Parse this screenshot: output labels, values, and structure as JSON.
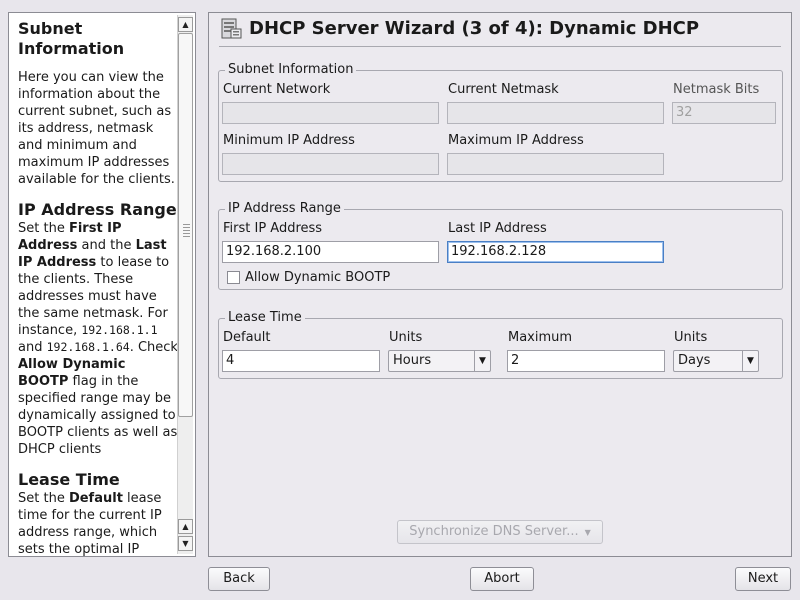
{
  "help": {
    "title": "Subnet Information",
    "intro": "Here you can view the information about the current subnet, such as its address, netmask and minimum and maximum IP addresses available for the clients.",
    "range_heading": "IP Address Range",
    "range_p1": "Set the ",
    "range_b1": "First IP Address",
    "range_p2": " and the ",
    "range_b2": "Last IP Address",
    "range_p3": " to lease to the clients. These addresses must have the same netmask. For instance, ",
    "range_code1": "192.168.1.1",
    "range_p4": " and ",
    "range_code2": "192.168.1.64",
    "range_p5": ". Check ",
    "range_b3": "Allow Dynamic BOOTP",
    "range_p6": " flag in the specified range may be dynamically assigned to BOOTP clients as well as DHCP clients",
    "lease_heading": "Lease Time",
    "lease_p1": "Set the ",
    "lease_b1": "Default",
    "lease_p2": " lease time for the current IP address range, which sets the optimal IP refreshing time for"
  },
  "wizard": {
    "title": "DHCP Server Wizard (3 of 4): Dynamic DHCP",
    "subnet": {
      "legend": "Subnet Information",
      "current_network_label": "Current Network",
      "current_network_value": "",
      "current_netmask_label": "Current Netmask",
      "current_netmask_value": "",
      "netmask_bits_label": "Netmask Bits",
      "netmask_bits_value": "32",
      "min_ip_label": "Minimum IP Address",
      "min_ip_value": "",
      "max_ip_label": "Maximum IP Address",
      "max_ip_value": ""
    },
    "range": {
      "legend": "IP Address Range",
      "first_label": "First IP Address",
      "first_value": "192.168.2.100",
      "last_label": "Last IP Address",
      "last_value": "192.168.2.128",
      "bootp_label": "Allow Dynamic BOOTP",
      "bootp_checked": false
    },
    "lease": {
      "legend": "Lease Time",
      "default_label": "Default",
      "default_value": "4",
      "units1_label": "Units",
      "units1_value": "Hours",
      "maximum_label": "Maximum",
      "maximum_value": "2",
      "units2_label": "Units",
      "units2_value": "Days"
    },
    "sync_dns_label": "Synchronize DNS Server..."
  },
  "nav": {
    "back": "Back",
    "abort": "Abort",
    "next": "Next"
  },
  "colors": {
    "focus": "#4a7fc4",
    "window_bg": "#e8e6ec"
  }
}
